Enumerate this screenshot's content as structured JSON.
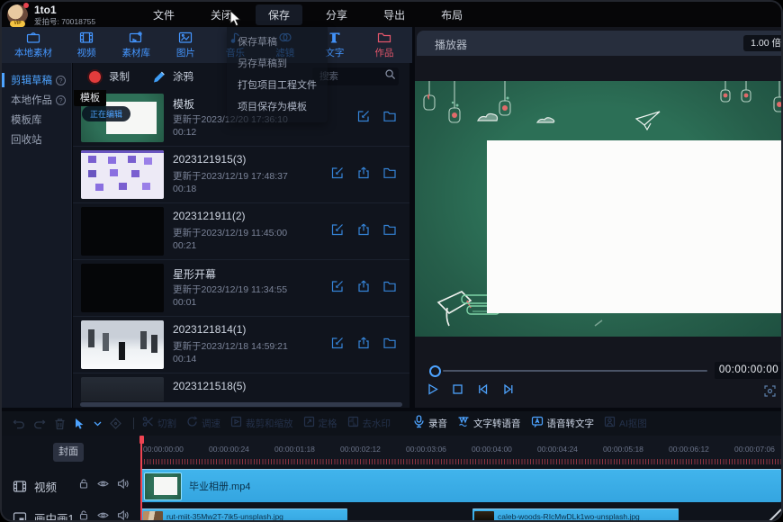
{
  "titlebar": {
    "app_title": "1to1",
    "account_label": "爱拍号: 70018755",
    "vip_badge": "VIP",
    "menus": [
      "文件",
      "关闭",
      "保存",
      "分享",
      "导出",
      "布局"
    ]
  },
  "save_dropdown": {
    "items": [
      "保存草稿",
      "另存草稿到",
      "打包项目工程文件",
      "项目保存为模板"
    ]
  },
  "tabbar": {
    "tabs": [
      {
        "label": "本地素材"
      },
      {
        "label": "视频"
      },
      {
        "label": "素材库"
      },
      {
        "label": "图片"
      },
      {
        "label": "音乐"
      },
      {
        "label": "滤镜"
      },
      {
        "label": "文字"
      },
      {
        "label": "作品"
      }
    ]
  },
  "sidenav": {
    "items": [
      {
        "label": "剪辑草稿"
      },
      {
        "label": "本地作品"
      },
      {
        "label": "模板库"
      },
      {
        "label": "回收站"
      }
    ]
  },
  "library": {
    "record_label": "录制",
    "doodle_label": "涂鸦",
    "search_placeholder": "搜索",
    "tooltip_text": "模板",
    "editing_badge": "正在编辑",
    "items": [
      {
        "title": "模板",
        "updated": "更新于2023/12/20 17:36:10",
        "duration": "00:12"
      },
      {
        "title": "2023121915(3)",
        "updated": "更新于2023/12/19 17:48:37",
        "duration": "00:18"
      },
      {
        "title": "2023121911(2)",
        "updated": "更新于2023/12/19 11:45:00",
        "duration": "00:21"
      },
      {
        "title": "星形开幕",
        "updated": "更新于2023/12/19 11:34:55",
        "duration": "00:01"
      },
      {
        "title": "2023121814(1)",
        "updated": "更新于2023/12/18 14:59:21",
        "duration": "00:14"
      },
      {
        "title": "2023121518(5)",
        "updated": "",
        "duration": ""
      }
    ]
  },
  "player": {
    "title": "播放器",
    "zoom_value": "1.00 倍",
    "timecode": "00:00:00:00"
  },
  "toolbar": {
    "tools": [
      {
        "label": "切割"
      },
      {
        "label": "调速"
      },
      {
        "label": "裁剪和缩放"
      },
      {
        "label": "定格"
      },
      {
        "label": "去水印"
      },
      {
        "label": "录音"
      },
      {
        "label": "文字转语音"
      },
      {
        "label": "语音转文字"
      },
      {
        "label": "AI抠图"
      }
    ]
  },
  "timeline": {
    "cover_label": "封面",
    "ruler_ticks": [
      "00:00:00:00",
      "00:00:00:24",
      "00:00:01:18",
      "00:00:02:12",
      "00:00:03:06",
      "00:00:04:00",
      "00:00:04:24",
      "00:00:05:18",
      "00:00:06:12",
      "00:00:07:06"
    ],
    "tracks": [
      {
        "name": "视频",
        "clips": [
          {
            "label": "毕业相册.mp4"
          }
        ]
      },
      {
        "name": "画中画1",
        "clips": [
          {
            "label": "rut-miit-35Mw2T-7ik5-unsplash.jpg"
          },
          {
            "label": "caleb-woods-RIcMwDLk1wo-unsplash.jpg"
          }
        ]
      }
    ]
  },
  "colors": {
    "accent_blue": "#4496ff",
    "works_red": "#e4566b",
    "clip_cyan": "#3fb2ea",
    "playhead_red": "#ef4452",
    "chalkboard_green": "#2a6b52"
  }
}
